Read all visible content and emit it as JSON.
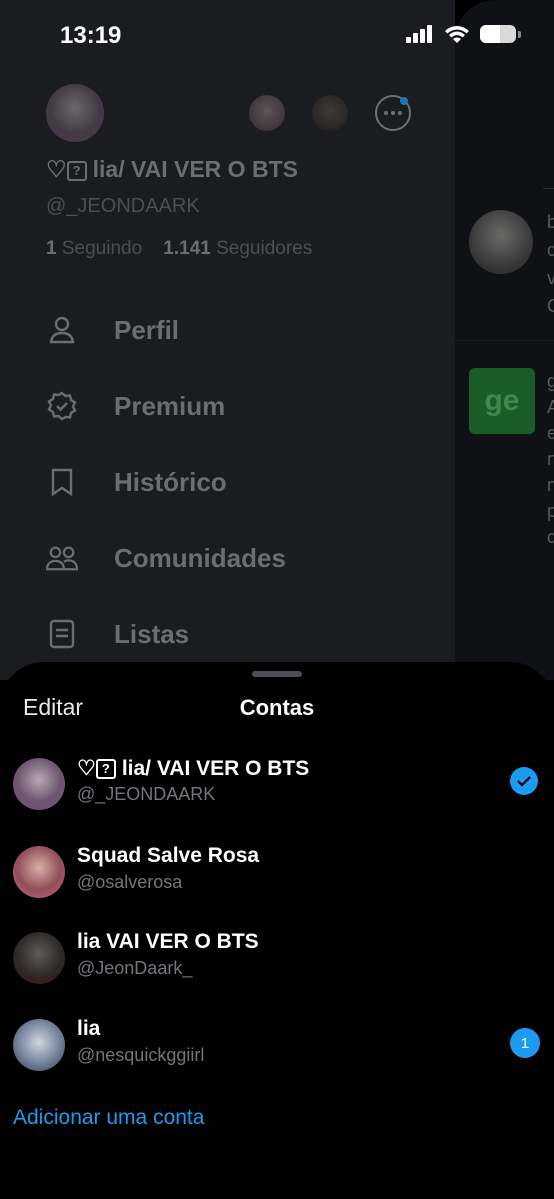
{
  "status_bar": {
    "time": "13:19",
    "battery_level": 0.55
  },
  "drawer": {
    "display_name_prefix": "♡",
    "display_name_box": "?",
    "display_name": "lia/ VAI VER O BTS",
    "handle": "@_JEONDAARK",
    "following_count": "1",
    "following_label": "Seguindo",
    "followers_count": "1.141",
    "followers_label": "Seguidores",
    "menu": [
      {
        "label": "Perfil",
        "icon": "person-icon"
      },
      {
        "label": "Premium",
        "icon": "verified-badge-icon"
      },
      {
        "label": "Histórico",
        "icon": "bookmark-icon"
      },
      {
        "label": "Comunidades",
        "icon": "communities-icon"
      },
      {
        "label": "Listas",
        "icon": "list-icon"
      }
    ]
  },
  "feed_peek": {
    "ge_label": "ge"
  },
  "sheet": {
    "edit_label": "Editar",
    "title": "Contas",
    "accounts": [
      {
        "name_prefix": "♡",
        "name_box": "?",
        "name": "lia/ VAI VER O BTS",
        "handle": "@_JEONDAARK",
        "selected": true
      },
      {
        "name": "Squad Salve Rosa",
        "handle": "@osalverosa"
      },
      {
        "name": "lia VAI VER O BTS",
        "handle": "@JeonDaark_"
      },
      {
        "name": "lia",
        "handle": "@nesquickggiirl",
        "badge": "1"
      }
    ],
    "add_account_label": "Adicionar uma conta"
  },
  "colors": {
    "accent": "#1d9bf0",
    "background": "#000000"
  }
}
